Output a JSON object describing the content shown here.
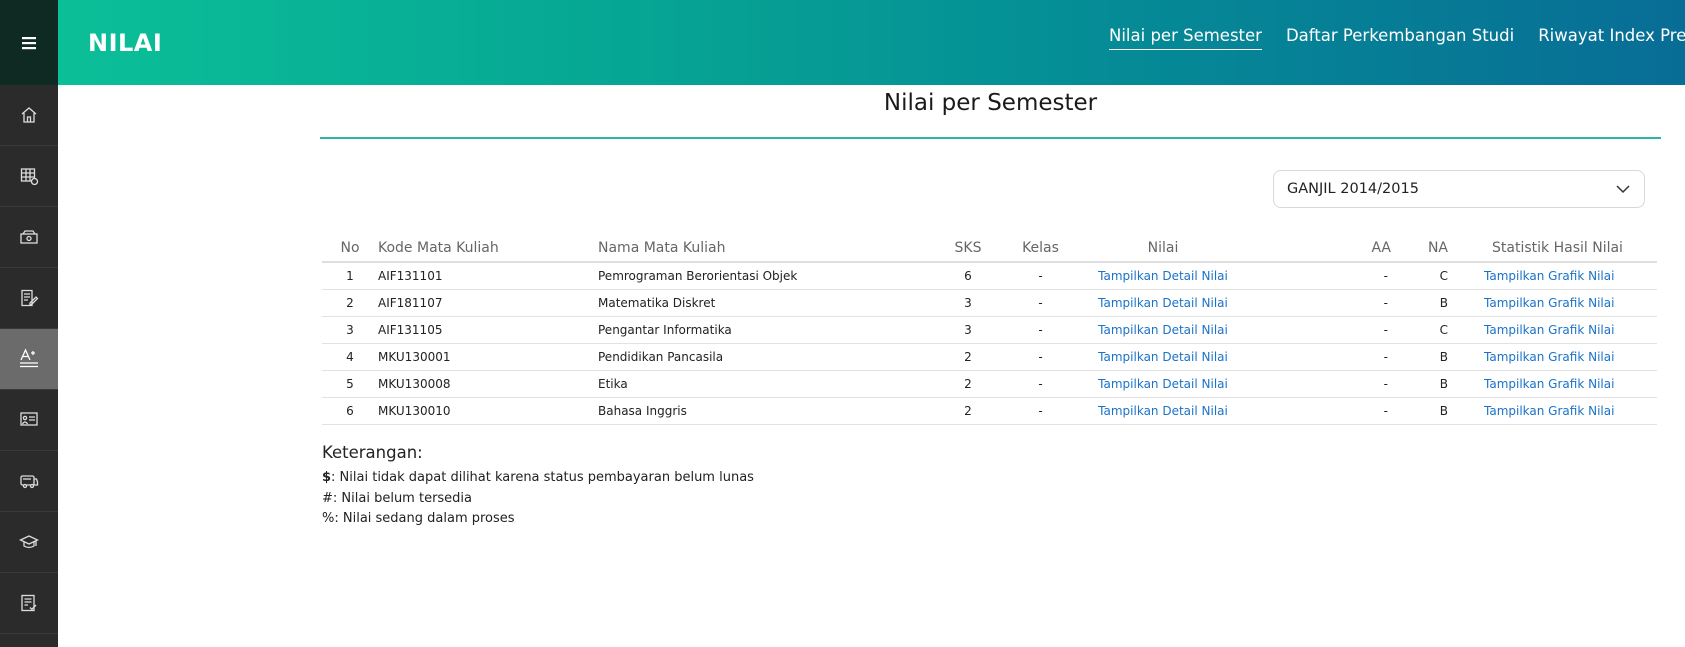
{
  "header": {
    "brand": "NILAI",
    "nav": [
      {
        "label": "Nilai per Semester",
        "active": true
      },
      {
        "label": "Daftar Perkembangan Studi",
        "active": false
      },
      {
        "label": "Riwayat Index Prest",
        "active": false
      }
    ]
  },
  "sidebar": {
    "icons": [
      "menu-icon",
      "home-icon",
      "schedule-icon",
      "payment-icon",
      "edit-document-icon",
      "grades-icon",
      "presentation-icon",
      "bus-icon",
      "graduation-cap-icon",
      "checklist-icon"
    ],
    "active_index": 5
  },
  "main": {
    "title": "Nilai per Semester",
    "semester_select": {
      "value": "GANJIL 2014/2015"
    },
    "table": {
      "headers": [
        "No",
        "Kode Mata Kuliah",
        "Nama Mata Kuliah",
        "SKS",
        "Kelas",
        "Nilai",
        "AA",
        "NA",
        "Statistik Hasil Nilai"
      ],
      "rows": [
        {
          "no": "1",
          "kode": "AIF131101",
          "nama": "Pemrograman Berorientasi Objek",
          "sks": "6",
          "kelas": "-",
          "nilai": "Tampilkan Detail Nilai",
          "aa": "-",
          "na": "C",
          "statistik": "Tampilkan Grafik Nilai"
        },
        {
          "no": "2",
          "kode": "AIF181107",
          "nama": "Matematika Diskret",
          "sks": "3",
          "kelas": "-",
          "nilai": "Tampilkan Detail Nilai",
          "aa": "-",
          "na": "B",
          "statistik": "Tampilkan Grafik Nilai"
        },
        {
          "no": "3",
          "kode": "AIF131105",
          "nama": "Pengantar Informatika",
          "sks": "3",
          "kelas": "-",
          "nilai": "Tampilkan Detail Nilai",
          "aa": "-",
          "na": "C",
          "statistik": "Tampilkan Grafik Nilai"
        },
        {
          "no": "4",
          "kode": "MKU130001",
          "nama": "Pendidikan Pancasila",
          "sks": "2",
          "kelas": "-",
          "nilai": "Tampilkan Detail Nilai",
          "aa": "-",
          "na": "B",
          "statistik": "Tampilkan Grafik Nilai"
        },
        {
          "no": "5",
          "kode": "MKU130008",
          "nama": "Etika",
          "sks": "2",
          "kelas": "-",
          "nilai": "Tampilkan Detail Nilai",
          "aa": "-",
          "na": "B",
          "statistik": "Tampilkan Grafik Nilai"
        },
        {
          "no": "6",
          "kode": "MKU130010",
          "nama": "Bahasa Inggris",
          "sks": "2",
          "kelas": "-",
          "nilai": "Tampilkan Detail Nilai",
          "aa": "-",
          "na": "B",
          "statistik": "Tampilkan Grafik Nilai"
        }
      ]
    },
    "notes": {
      "heading": "Keterangan:",
      "lines": [
        {
          "symbol": "$",
          "text": ": Nilai tidak dapat dilihat karena status pembayaran belum lunas"
        },
        {
          "symbol": "#",
          "text": ": Nilai belum tersedia"
        },
        {
          "symbol": "%",
          "text": ": Nilai sedang dalam proses"
        }
      ]
    }
  },
  "colors": {
    "link": "#1a73c8",
    "accent": "#2fb3a5",
    "header_start": "#0bbf98",
    "header_end": "#086d96",
    "sidebar": "#2b2b2b"
  }
}
